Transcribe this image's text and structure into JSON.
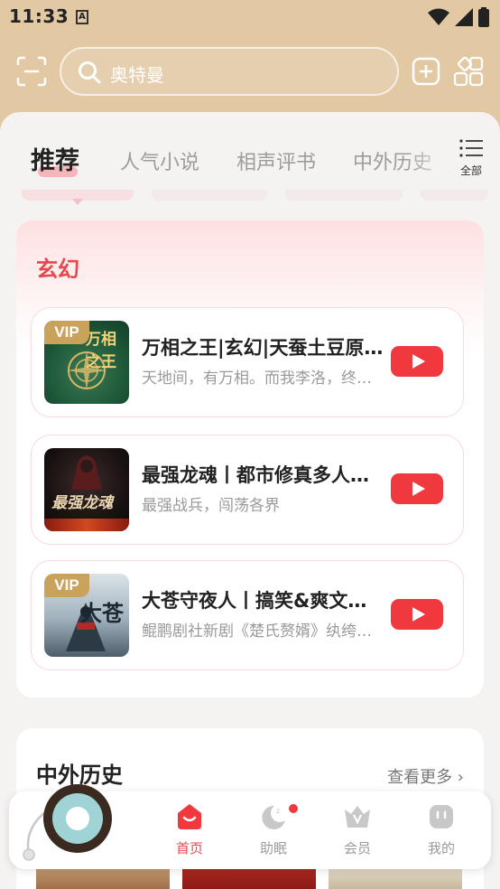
{
  "status_bar": {
    "time": "11:33",
    "notification_icon": "A"
  },
  "search": {
    "placeholder": "奥特曼"
  },
  "tabs": [
    {
      "label": "推荐",
      "active": true
    },
    {
      "label": "人气小说",
      "active": false
    },
    {
      "label": "相声评书",
      "active": false
    },
    {
      "label": "中外历史",
      "active": false
    }
  ],
  "all_button": {
    "label": "全部"
  },
  "section1": {
    "title": "玄幻",
    "books": [
      {
        "title": "万相之王|玄幻|天蚕土豆原著|多人有声剧",
        "desc": "天地间，有万相。而我李洛，终将成为这万相之王",
        "vip": "VIP",
        "cover_text": "万相之王"
      },
      {
        "title": "最强龙魂丨都市修真多人有声剧",
        "desc": "最强战兵，闯荡各界",
        "vip": "",
        "cover_text": "最强龙魂"
      },
      {
        "title": "大苍守夜人丨搞笑&爽文丨多人有声剧",
        "desc": "鲲鹏剧社新剧《楚氏赘婿》纨绔少爷",
        "vip": "VIP",
        "cover_text": "大苍"
      }
    ]
  },
  "section2": {
    "title": "中外历史",
    "see_more": "查看更多"
  },
  "bottom_nav": [
    {
      "label": "首页",
      "active": true,
      "icon": "home-icon"
    },
    {
      "label": "助眠",
      "active": false,
      "icon": "sleep-moon-icon"
    },
    {
      "label": "会员",
      "active": false,
      "icon": "vip-crown-icon"
    },
    {
      "label": "我的",
      "active": false,
      "icon": "profile-icon"
    }
  ],
  "colors": {
    "accent": "#e5484d",
    "header": "#e2c9a4",
    "play": "#f0393f"
  }
}
